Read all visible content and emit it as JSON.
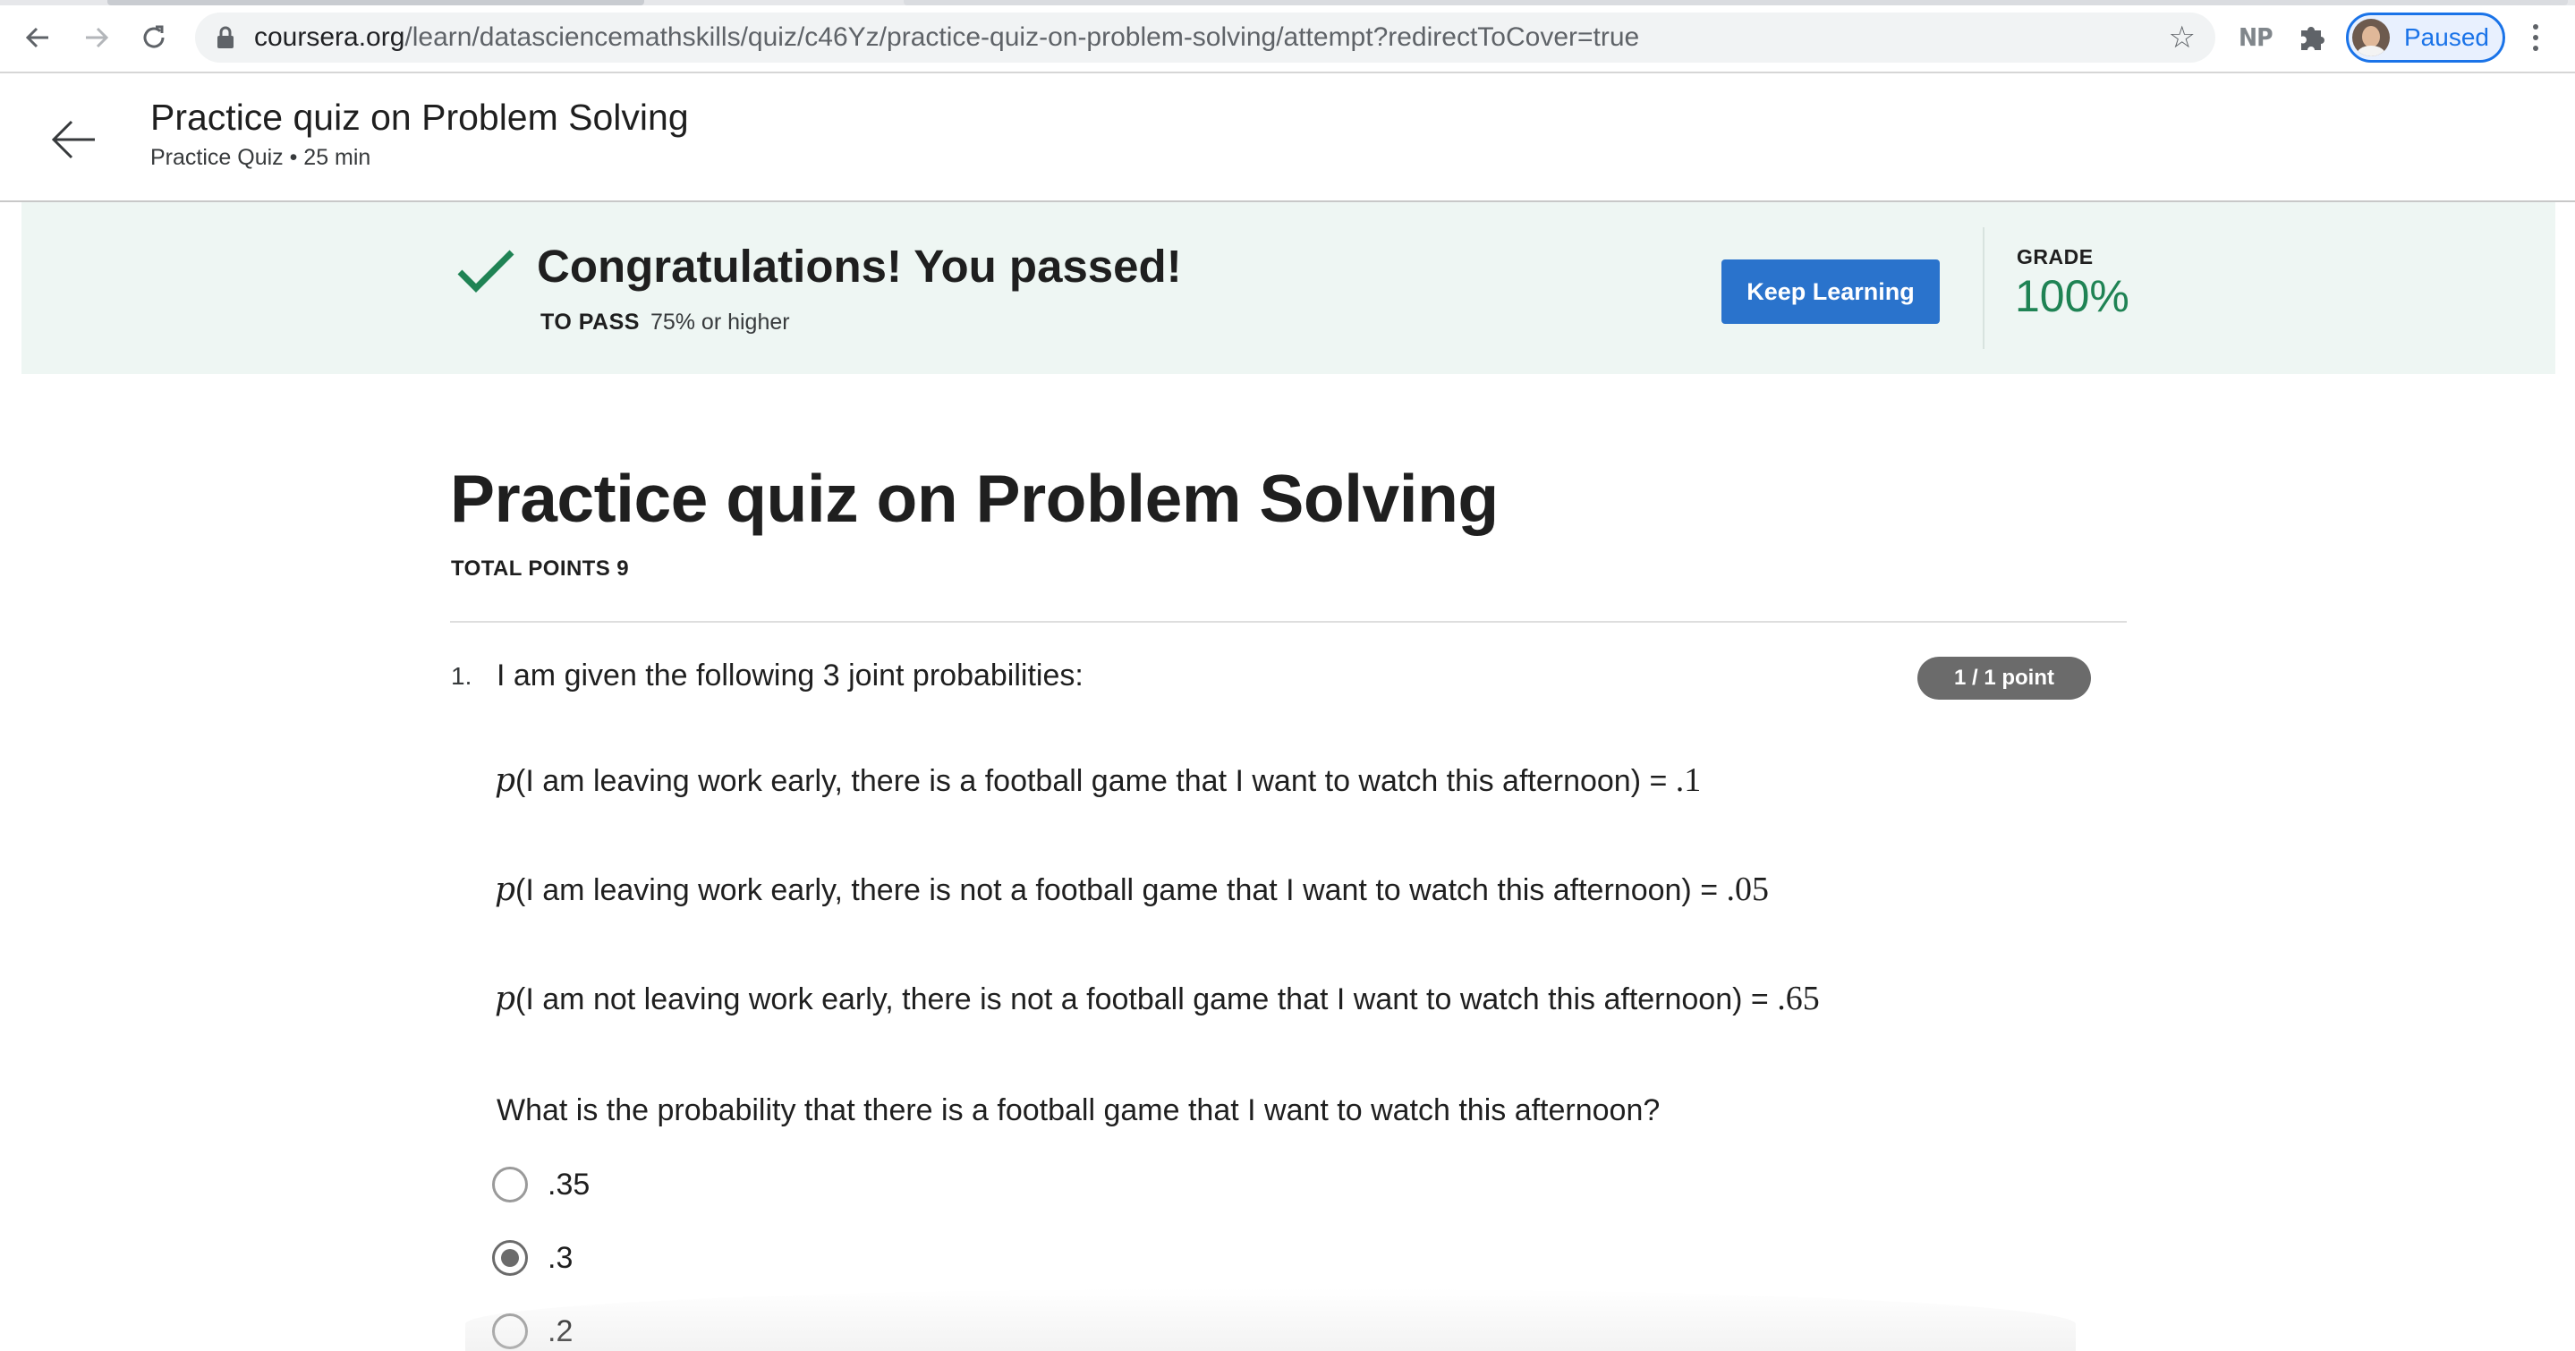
{
  "browser": {
    "url_host": "coursera.org",
    "url_path": "/learn/datasciencemathskills/quiz/c46Yz/practice-quiz-on-problem-solving/attempt?redirectToCover=true",
    "extension_label": "NP",
    "profile_label": "Paused",
    "icons": [
      "back-icon",
      "forward-icon",
      "reload-icon",
      "lock-icon",
      "star-icon",
      "puzzle-icon",
      "more-vert-icon"
    ]
  },
  "header": {
    "title": "Practice quiz on Problem Solving",
    "subtitle": "Practice Quiz • 25 min"
  },
  "banner": {
    "message": "Congratulations! You passed!",
    "to_pass_label": "TO PASS",
    "to_pass_value": "75% or higher",
    "button_label": "Keep Learning",
    "grade_label": "GRADE",
    "grade_value": "100%",
    "accent_color": "#1f8354",
    "button_color": "#2a73cc"
  },
  "quiz": {
    "title": "Practice quiz on Problem Solving",
    "total_points": "TOTAL POINTS 9",
    "question": {
      "number": "1.",
      "intro": "I am given the following 3 joint probabilities:",
      "points": "1 / 1 point",
      "probabilities": [
        {
          "symbol": "p",
          "text": "(I am leaving work early, there is a football game that I want to watch this afternoon) = ",
          "value": ".1"
        },
        {
          "symbol": "p",
          "text": "(I am leaving work early, there is not a football game that I want to watch this afternoon) = ",
          "value": ".05"
        },
        {
          "symbol": "p",
          "text": "(I am not leaving work early, there is not a football game that I want to watch this afternoon) = ",
          "value": ".65"
        }
      ],
      "prompt": "What is the probability that there is a football game that I want to watch this afternoon?",
      "options": [
        {
          "label": ".35",
          "selected": false
        },
        {
          "label": ".3",
          "selected": true
        },
        {
          "label": ".2",
          "selected": false
        }
      ]
    }
  }
}
